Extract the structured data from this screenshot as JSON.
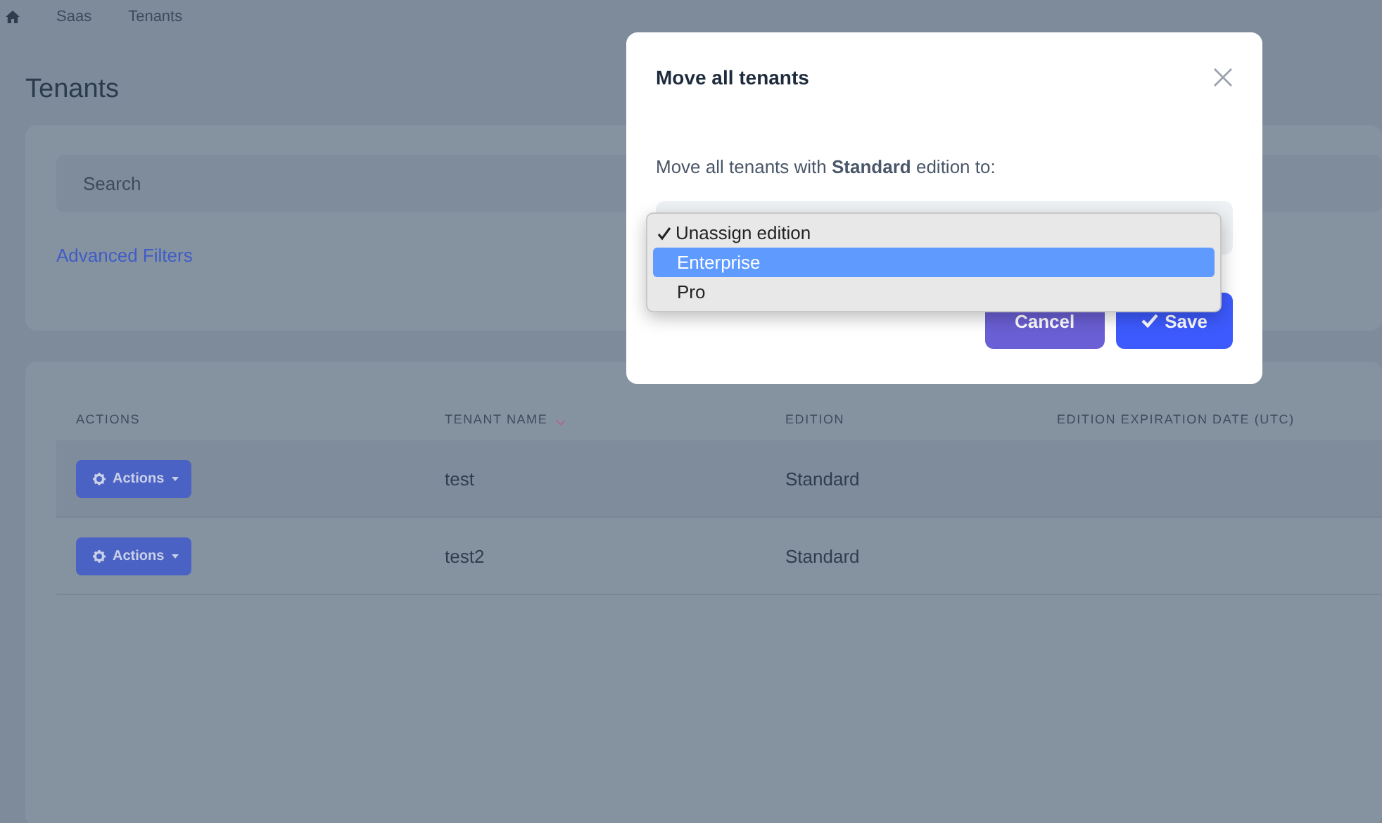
{
  "breadcrumb": [
    "Saas",
    "Tenants"
  ],
  "page_title": "Tenants",
  "filters": {
    "search": {
      "placeholder": "Search"
    },
    "advanced_filters": "Advanced Filters"
  },
  "table": {
    "columns": [
      {
        "label": "ACTIONS",
        "sorted": false
      },
      {
        "label": "TENANT NAME",
        "sorted": true
      },
      {
        "label": "EDITION",
        "sorted": false
      },
      {
        "label": "EDITION EXPIRATION DATE (UTC)",
        "sorted": false
      }
    ],
    "rows": [
      {
        "action": "Actions",
        "name": "test",
        "edition": "Standard"
      },
      {
        "action": "Actions",
        "name": "test2",
        "edition": "Standard"
      }
    ]
  },
  "modal": {
    "title": "Move all tenants",
    "message": "Move all tenants with **Standard** edition to:",
    "options": [
      {
        "label": "Unassign edition",
        "selected": true,
        "highlighted": false
      },
      {
        "label": "Enterprise",
        "selected": false,
        "highlighted": true
      },
      {
        "label": "Pro",
        "selected": false,
        "highlighted": false
      }
    ],
    "buttons": [
      {
        "kind": "cancel",
        "label": "Cancel"
      },
      {
        "kind": "save",
        "label": "Save"
      }
    ]
  }
}
